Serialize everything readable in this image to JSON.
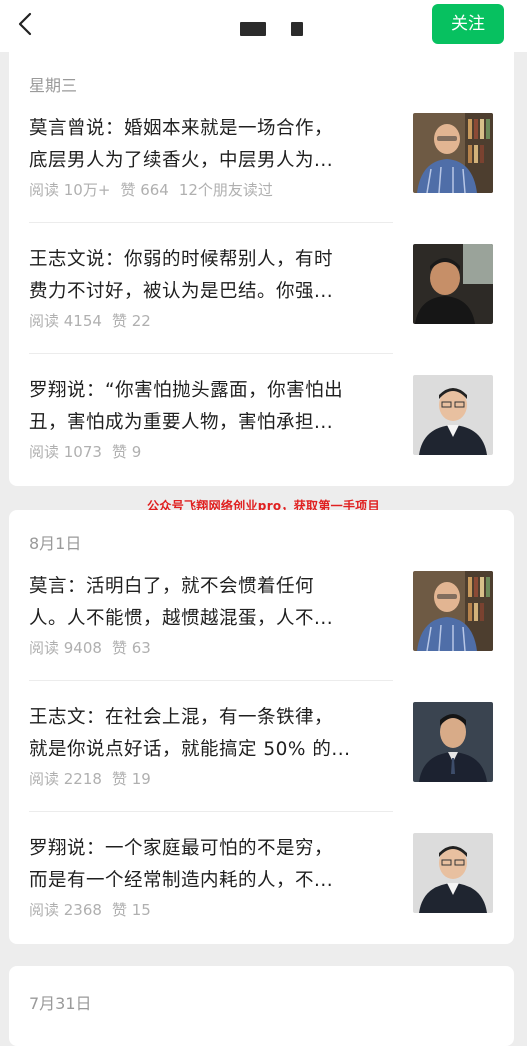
{
  "header": {
    "back_icon": "chevron-left-icon",
    "follow_label": "关注",
    "accent_color": "#07c160"
  },
  "sections": [
    {
      "date": "星期三",
      "articles": [
        {
          "line1": "莫言曾说：婚姻本来就是一场合作，",
          "line2": "底层男人为了续香火，中层男人为...",
          "reads": "阅读 10万+",
          "likes": "赞 664",
          "friends": "12个朋友读过",
          "thumb": "portrait-elderly-man-bookshelf"
        },
        {
          "line1": "王志文说：你弱的时候帮别人，有时",
          "line2": "费力不讨好，被认为是巴结。你强...",
          "reads": "阅读 4154",
          "likes": "赞 22",
          "thumb": "portrait-man-in-car"
        },
        {
          "line1": "罗翔说：“你害怕抛头露面，你害怕出",
          "line2": "丑，害怕成为重要人物，害怕承担...",
          "reads": "阅读 1073",
          "likes": "赞 9",
          "thumb": "portrait-man-suit"
        }
      ]
    },
    {
      "date": "8月1日",
      "articles": [
        {
          "line1": "莫言：活明白了，就不会惯着任何",
          "line2": "人。人不能惯，越惯越混蛋，人不...",
          "reads": "阅读 9408",
          "likes": "赞 63",
          "thumb": "portrait-elderly-man-bookshelf"
        },
        {
          "line1": "王志文：在社会上混，有一条铁律，",
          "line2": "就是你说点好话，就能搞定 50% 的...",
          "reads": "阅读 2218",
          "likes": "赞 19",
          "thumb": "portrait-man-dark-suit"
        },
        {
          "line1": "罗翔说：一个家庭最可怕的不是穷，",
          "line2": "而是有一个经常制造内耗的人，不...",
          "reads": "阅读 2368",
          "likes": "赞 15",
          "thumb": "portrait-man-suit"
        }
      ]
    },
    {
      "date": "7月31日"
    }
  ],
  "watermark": "公众号飞翔网络创业pro，获取第一手项目"
}
